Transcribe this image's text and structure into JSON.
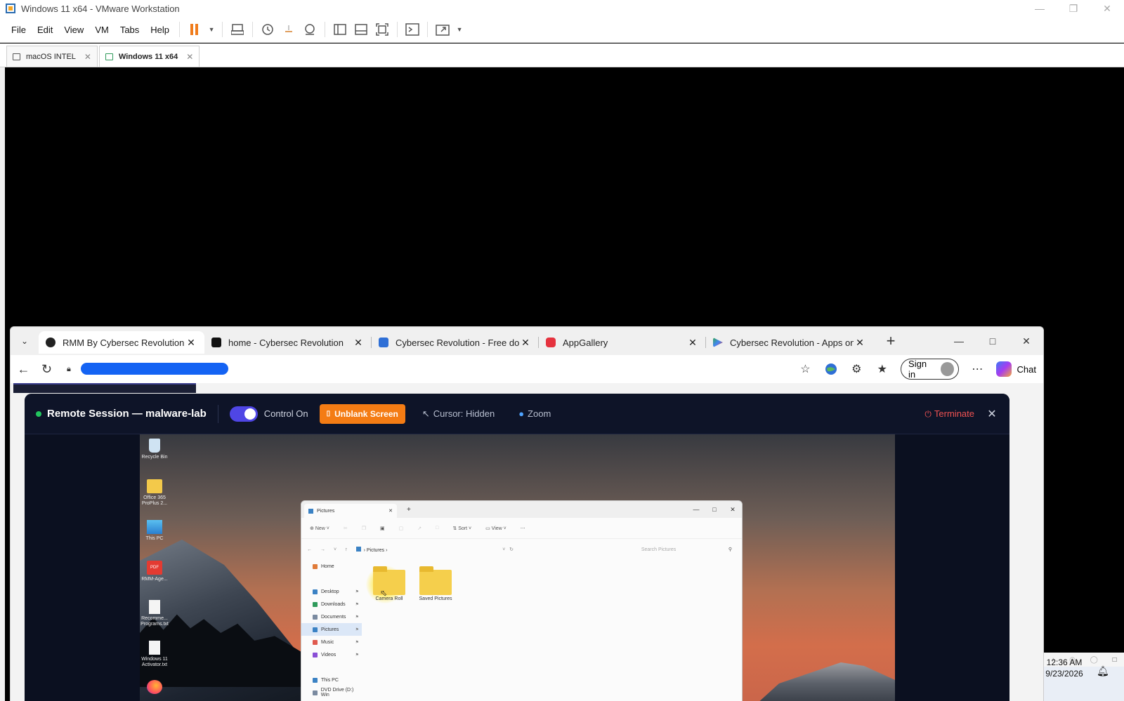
{
  "vmware": {
    "title": "Windows 11 x64 - VMware Workstation",
    "menu": [
      "File",
      "Edit",
      "View",
      "VM",
      "Tabs",
      "Help"
    ],
    "tabs": [
      {
        "label": "macOS INTEL",
        "active": false
      },
      {
        "label": "Windows 11 x64",
        "active": true
      }
    ]
  },
  "browser": {
    "tabs": [
      {
        "label": "RMM By Cybersec Revolution",
        "active": true,
        "icon_color": "#222222"
      },
      {
        "label": "home - Cybersec Revolution",
        "active": false,
        "icon_color": "#111111"
      },
      {
        "label": "Cybersec Revolution - Free down",
        "active": false,
        "icon_color": "#2f6fd6"
      },
      {
        "label": "AppGallery",
        "active": false,
        "icon_color": "#e5323e"
      },
      {
        "label": "Cybersec Revolution - Apps on G",
        "active": false,
        "icon_color": "#34a853"
      }
    ],
    "sign_in": "Sign in",
    "chat": "Chat"
  },
  "rmm": {
    "session_title": "Remote Session — malware-lab",
    "control_label": "Control On",
    "control_on": true,
    "unblank_label": "Unblank Screen",
    "cursor_label": "Cursor: Hidden",
    "zoom_label": "Zoom",
    "terminate_label": "Terminate"
  },
  "remote_desktop": {
    "icons": [
      {
        "label": "Recycle Bin",
        "icon": "recycle-bin-icon"
      },
      {
        "label": "Office 365 ProPlus 2...",
        "icon": "folder-icon"
      },
      {
        "label": "This PC",
        "icon": "monitor-icon"
      },
      {
        "label": "RMM-Age...",
        "icon": "pdf-icon"
      },
      {
        "label": "Recomme... Programs.txt",
        "icon": "text-file-icon"
      },
      {
        "label": "Windows 11 Activator.txt",
        "icon": "text-file-icon"
      }
    ],
    "explorer": {
      "tab_title": "Pictures",
      "commands": [
        "New",
        "Sort",
        "View"
      ],
      "breadcrumb": "Pictures",
      "search_placeholder": "Search Pictures",
      "nav": [
        {
          "label": "Home",
          "icon_color": "#e07b39",
          "pinned": false,
          "selected": false
        },
        {
          "label": "Desktop",
          "icon_color": "#3b82c4",
          "pinned": true,
          "selected": false
        },
        {
          "label": "Downloads",
          "icon_color": "#2f9a5b",
          "pinned": true,
          "selected": false
        },
        {
          "label": "Documents",
          "icon_color": "#7a8aa0",
          "pinned": true,
          "selected": false
        },
        {
          "label": "Pictures",
          "icon_color": "#3b82c4",
          "pinned": true,
          "selected": true
        },
        {
          "label": "Music",
          "icon_color": "#e05a4f",
          "pinned": true,
          "selected": false
        },
        {
          "label": "Videos",
          "icon_color": "#8a4fd6",
          "pinned": true,
          "selected": false
        },
        {
          "label": "This PC",
          "icon_color": "#3b82c4",
          "pinned": false,
          "selected": false
        },
        {
          "label": "DVD Drive (D:) Win",
          "icon_color": "#7a8aa0",
          "pinned": false,
          "selected": false
        }
      ],
      "folders": [
        {
          "label": "Camera Roll"
        },
        {
          "label": "Saved Pictures"
        }
      ]
    }
  },
  "taskbar": {
    "time": "12:36 AM",
    "date": "9/23/2026"
  }
}
